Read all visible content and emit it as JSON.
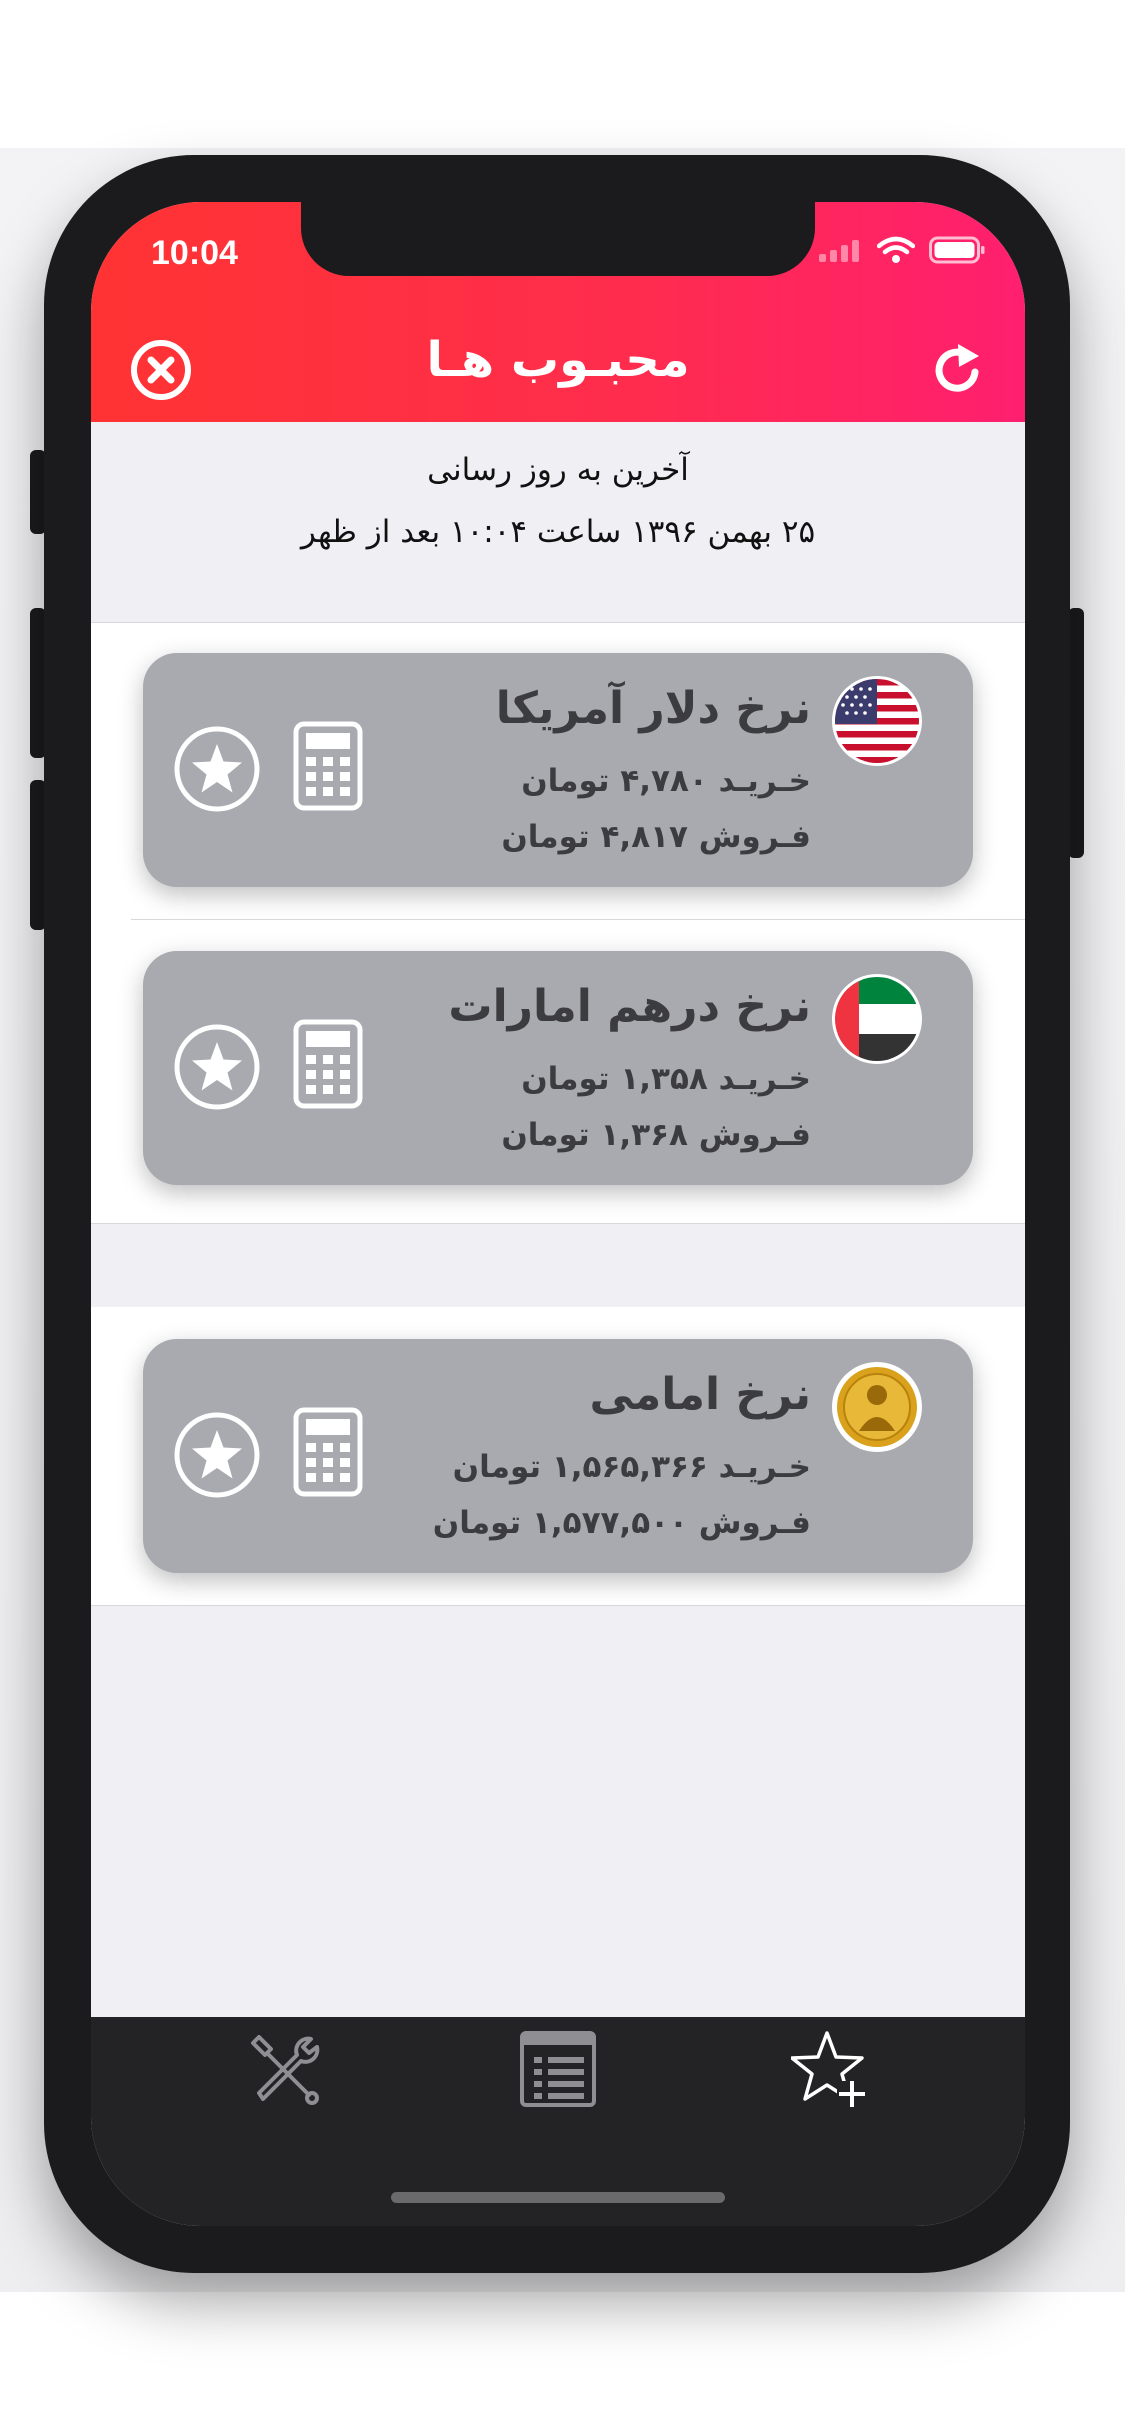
{
  "status_bar": {
    "time": "10:04"
  },
  "header": {
    "title": "محبـوب هـا"
  },
  "update": {
    "label": "آخرین به روز رسانی",
    "datetime": "۲۵ بهمن ۱۳۹۶ ساعت ۱۰:۰۴ بعد از ظهر"
  },
  "cards": [
    {
      "title": "نرخ دلار آمریکا",
      "buy": "خـریـد ۴,۷۸۰ تومان",
      "sell": "فـروش ۴,۸۱۷ تومان",
      "flag": "us-flag-icon"
    },
    {
      "title": "نرخ درهم امارات",
      "buy": "خـریـد ۱,۳۵۸ تومان",
      "sell": "فـروش ۱,۳۶۸ تومان",
      "flag": "uae-flag-icon"
    },
    {
      "title": "نرخ امامی",
      "buy": "خـریـد ۱,۵۶۵,۳۶۶ تومان",
      "sell": "فـروش ۱,۵۷۷,۵۰۰ تومان",
      "flag": "gold-coin-icon"
    }
  ],
  "tabs": [
    "tools-icon",
    "news-list-icon",
    "add-favorite-icon"
  ],
  "colors": {
    "header_start": "#ff3333",
    "header_end": "#ff1f6f",
    "card_bg": "#a8aab0",
    "tabbar_bg": "#232325"
  }
}
